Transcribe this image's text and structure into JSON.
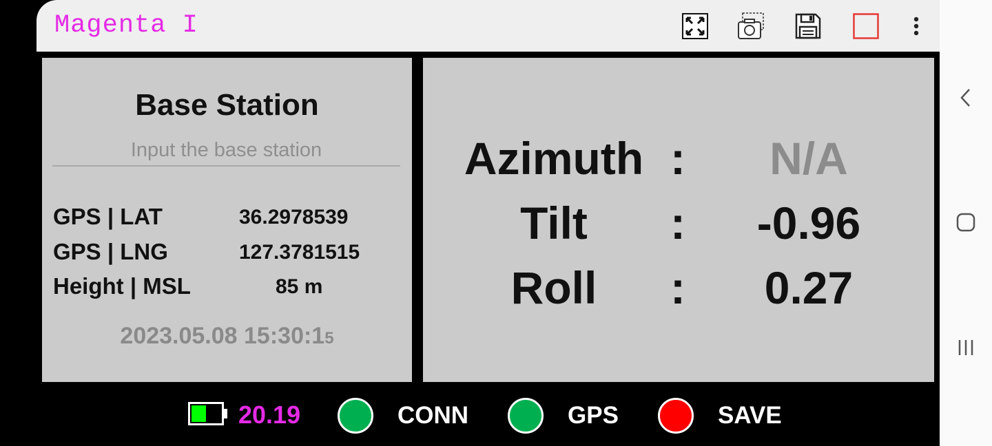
{
  "app": {
    "title": "Magenta I"
  },
  "toolbar": {
    "icons": [
      "fullscreen-icon",
      "screenshot-camera-icon",
      "save-disk-icon",
      "record-box-icon",
      "more-vert-icon"
    ],
    "record_color": "#e53935"
  },
  "base_station": {
    "title": "Base Station",
    "input_placeholder": "Input the base station",
    "rows": [
      {
        "label": "GPS | LAT",
        "value": "36.2978539"
      },
      {
        "label": "GPS | LNG",
        "value": "127.3781515"
      },
      {
        "label": "Height | MSL",
        "value": "85 m"
      }
    ],
    "timestamp_main": "2023.05.08 15:30:1",
    "timestamp_tail": "5"
  },
  "measurements": {
    "colon": ":",
    "azimuth": {
      "label": "Azimuth",
      "value": "N/A"
    },
    "tilt": {
      "label": "Tilt",
      "value": "-0.96"
    },
    "roll": {
      "label": "Roll",
      "value": "0.27"
    }
  },
  "status": {
    "battery_value": "20.19",
    "battery_level": 0.5,
    "battery_color": "#00ff00",
    "accent_color": "#e52ae5",
    "conn": {
      "label": "CONN",
      "color": "#00b050"
    },
    "gps": {
      "label": "GPS",
      "color": "#00b050"
    },
    "save": {
      "label": "SAVE",
      "color": "#ff0000"
    }
  },
  "system_nav": [
    "back-icon",
    "home-icon",
    "recents-icon"
  ]
}
